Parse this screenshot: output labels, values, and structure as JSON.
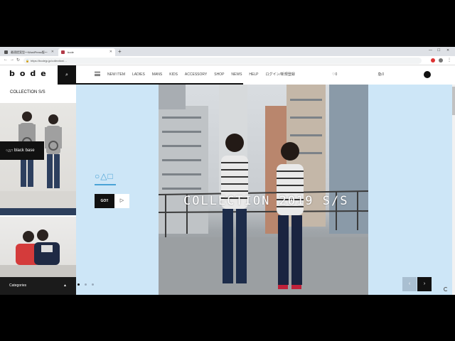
{
  "browser": {
    "tabs": [
      {
        "label": "最適提案型〜WordPress版〜"
      },
      {
        "label": "bode"
      }
    ],
    "new_tab": "+",
    "address": "https://bodejp.jp/collection/…",
    "controls": {
      "min": "—",
      "max": "☐",
      "close": "✕"
    }
  },
  "header": {
    "logo": "bode",
    "search_icon": "⌕",
    "nav": [
      "NEW ITEM",
      "LADIES",
      "MANS",
      "KIDS",
      "ACCESSORY",
      "SHOP",
      "NEWS",
      "HELP",
      "ログイン/新規登録"
    ],
    "favorites_count": "0",
    "cart_count": "0"
  },
  "sidebar": {
    "title": "COLLECTION S/S",
    "hover_label_mark": "○△□",
    "hover_label": "black base",
    "categories": "Categories",
    "categories_caret": "▲"
  },
  "hero": {
    "mark": "○△□",
    "go_label": "GO!!",
    "play_icon": "▷",
    "title": "COLLECTION 2019 S/S",
    "prev_icon": "‹",
    "next_icon": "›"
  },
  "colors": {
    "accent": "#4aa3d6",
    "hero_bg": "#cde6f7",
    "dark": "#111111"
  }
}
